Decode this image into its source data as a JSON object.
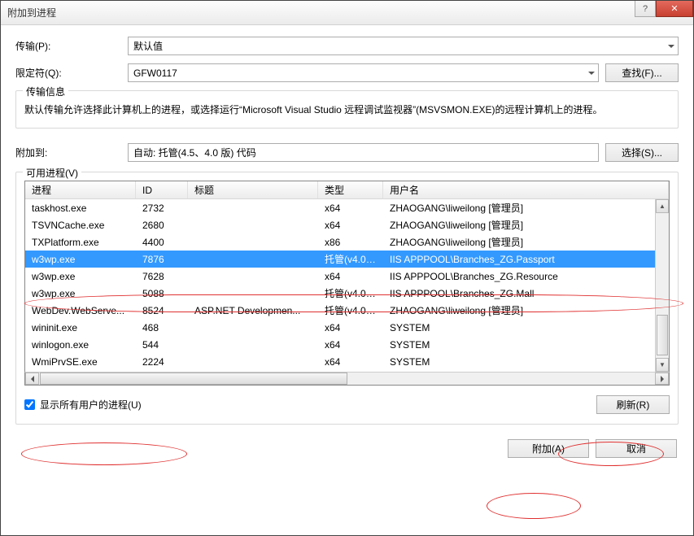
{
  "window": {
    "title": "附加到进程",
    "help_glyph": "?",
    "close_glyph": "✕"
  },
  "fields": {
    "transport_label": "传输(P):",
    "transport_value": "默认值",
    "qualifier_label": "限定符(Q):",
    "qualifier_value": "GFW0117",
    "find_btn": "查找(F)..."
  },
  "transport_info": {
    "legend": "传输信息",
    "text": "默认传输允许选择此计算机上的进程，或选择运行“Microsoft Visual Studio 远程调试监视器”(MSVSMON.EXE)的远程计算机上的进程。"
  },
  "attach": {
    "label": "附加到:",
    "value": "自动: 托管(4.5、4.0 版) 代码",
    "select_btn": "选择(S)..."
  },
  "processes": {
    "legend": "可用进程(V)",
    "columns": {
      "c1": "进程",
      "c2": "ID",
      "c3": "标题",
      "c4": "类型",
      "c5": "用户名"
    },
    "selected_index": 3,
    "rows": [
      {
        "proc": "taskhost.exe",
        "id": "2732",
        "title": "",
        "type": "x64",
        "user": "ZHAOGANG\\liweilong [管理员]"
      },
      {
        "proc": "TSVNCache.exe",
        "id": "2680",
        "title": "",
        "type": "x64",
        "user": "ZHAOGANG\\liweilong [管理员]"
      },
      {
        "proc": "TXPlatform.exe",
        "id": "4400",
        "title": "",
        "type": "x86",
        "user": "ZHAOGANG\\liweilong [管理员]"
      },
      {
        "proc": "w3wp.exe",
        "id": "7876",
        "title": "",
        "type": "托管(v4.0.30...",
        "user": "IIS APPPOOL\\Branches_ZG.Passport"
      },
      {
        "proc": "w3wp.exe",
        "id": "7628",
        "title": "",
        "type": "x64",
        "user": "IIS APPPOOL\\Branches_ZG.Resource"
      },
      {
        "proc": "w3wp.exe",
        "id": "5088",
        "title": "",
        "type": "托管(v4.0.30...",
        "user": "IIS APPPOOL\\Branches_ZG.Mall"
      },
      {
        "proc": "WebDev.WebServe...",
        "id": "8524",
        "title": "ASP.NET Developmen...",
        "type": "托管(v4.0.30...",
        "user": "ZHAOGANG\\liweilong [管理员]"
      },
      {
        "proc": "wininit.exe",
        "id": "468",
        "title": "",
        "type": "x64",
        "user": "SYSTEM"
      },
      {
        "proc": "winlogon.exe",
        "id": "544",
        "title": "",
        "type": "x64",
        "user": "SYSTEM"
      },
      {
        "proc": "WmiPrvSE.exe",
        "id": "2224",
        "title": "",
        "type": "x64",
        "user": "SYSTEM"
      }
    ],
    "show_all_label": "显示所有用户的进程(U)",
    "refresh_btn": "刷新(R)"
  },
  "dialog_buttons": {
    "attach": "附加(A)",
    "cancel": "取消"
  }
}
